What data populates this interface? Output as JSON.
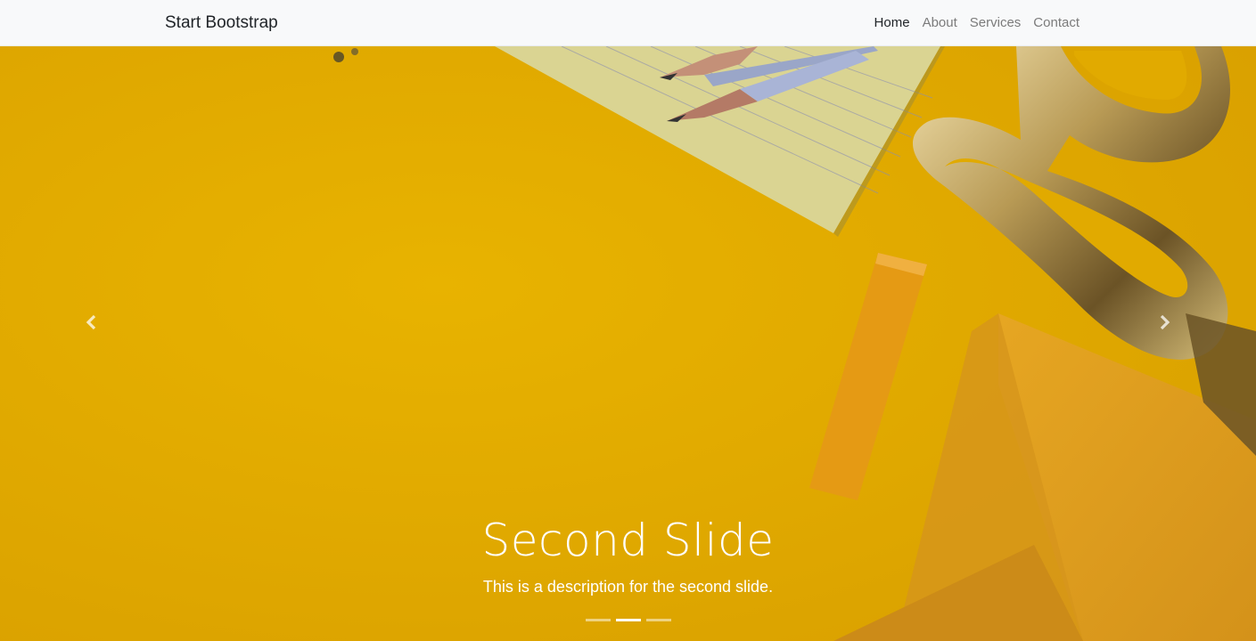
{
  "navbar": {
    "brand": "Start Bootstrap",
    "links": [
      {
        "label": "Home",
        "active": true
      },
      {
        "label": "About",
        "active": false
      },
      {
        "label": "Services",
        "active": false
      },
      {
        "label": "Contact",
        "active": false
      }
    ]
  },
  "carousel": {
    "active_slide": 2,
    "slide_count": 3,
    "caption": {
      "title": "Second Slide",
      "description": "This is a description for the second slide."
    },
    "prev_icon": "chevron-left-icon",
    "next_icon": "chevron-right-icon",
    "background_color": "#e2aa00"
  },
  "colors": {
    "navbar_bg": "#f8f9fa",
    "text_dark": "#212529",
    "text_muted": "#7b7b7b",
    "caption_text": "#ffffff"
  }
}
